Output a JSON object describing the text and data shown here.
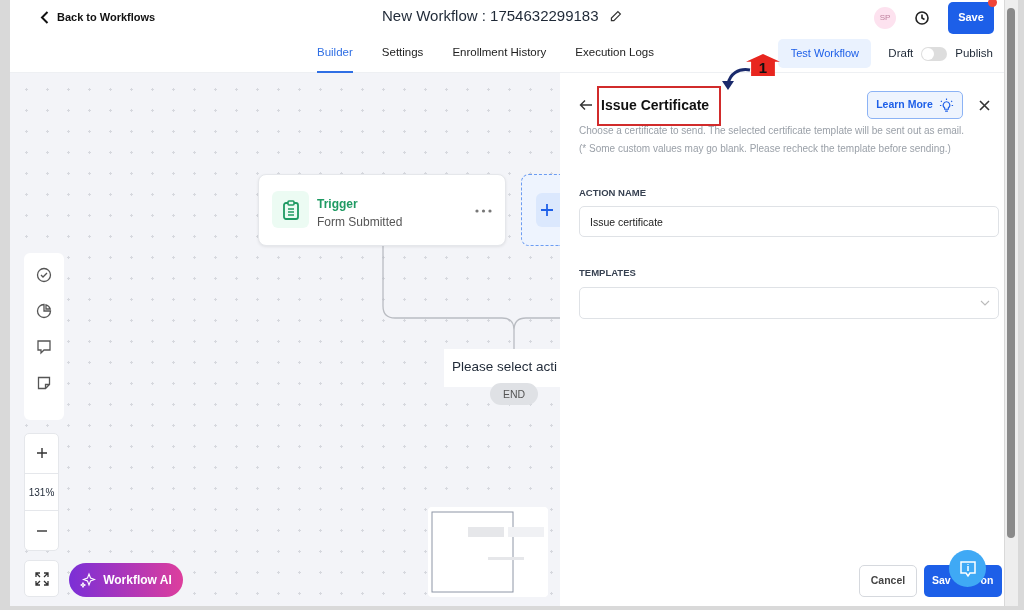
{
  "header": {
    "back": "Back to Workflows",
    "title": "New Workflow : 1754632299183",
    "avatar": "SP",
    "save": "Save",
    "save_notification": true
  },
  "tabs": [
    {
      "label": "Builder",
      "selected": true
    },
    {
      "label": "Settings",
      "selected": false
    },
    {
      "label": "Enrollment History",
      "selected": false
    },
    {
      "label": "Execution Logs",
      "selected": false
    }
  ],
  "test_workflow": "Test Workflow",
  "publish": {
    "off_label": "Draft",
    "on_label": "Publish",
    "on": false
  },
  "canvas": {
    "trigger": {
      "title": "Trigger",
      "subtitle": "Form Submitted"
    },
    "action_placeholder": "Please select acti",
    "end": "END",
    "zoom": "131%",
    "ai_button": "Workflow AI"
  },
  "panel": {
    "title": "Issue Certificate",
    "learn_more": "Learn More",
    "description": "Choose a certificate to send. The selected certificate template will be sent out as email.",
    "note": "(* Some custom values may go blank. Please recheck the template before sending.)",
    "fields": [
      {
        "label": "ACTION NAME",
        "kind": "text",
        "value": "Issue certificate"
      },
      {
        "label": "TEMPLATES",
        "kind": "select"
      }
    ],
    "cancel": "Cancel",
    "save_visible": [
      "Sav",
      "on"
    ]
  },
  "annotation": {
    "number": "1"
  }
}
